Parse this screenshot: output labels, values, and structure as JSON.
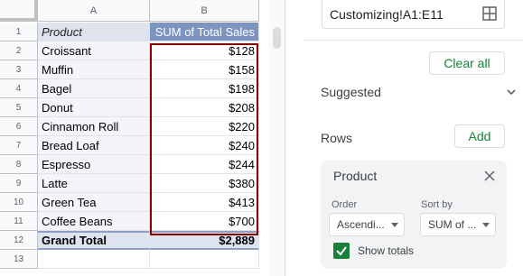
{
  "sheet": {
    "columns": [
      "A",
      "B"
    ],
    "row_numbers": [
      "1",
      "2",
      "3",
      "4",
      "5",
      "6",
      "7",
      "8",
      "9",
      "10",
      "11",
      "12",
      "13"
    ],
    "header": {
      "product": "Product",
      "sales": "SUM of Total Sales"
    },
    "rows": [
      {
        "product": "Croissant",
        "sales": "$128"
      },
      {
        "product": "Muffin",
        "sales": "$158"
      },
      {
        "product": "Bagel",
        "sales": "$198"
      },
      {
        "product": "Donut",
        "sales": "$208"
      },
      {
        "product": "Cinnamon Roll",
        "sales": "$220"
      },
      {
        "product": "Bread Loaf",
        "sales": "$240"
      },
      {
        "product": "Espresso",
        "sales": "$244"
      },
      {
        "product": "Latte",
        "sales": "$380"
      },
      {
        "product": "Green Tea",
        "sales": "$413"
      },
      {
        "product": "Coffee Beans",
        "sales": "$700"
      }
    ],
    "total": {
      "label": "Grand Total",
      "value": "$2,889"
    }
  },
  "pivot_editor": {
    "range": "Customizing!A1:E11",
    "clear_all": "Clear all",
    "suggested": "Suggested",
    "rows_label": "Rows",
    "add": "Add",
    "row_card": {
      "title": "Product",
      "order_label": "Order",
      "order_value": "Ascendi...",
      "sort_by_label": "Sort by",
      "sort_by_value": "SUM of ...",
      "show_totals": "Show totals",
      "show_totals_checked": true
    }
  },
  "colors": {
    "accent_green": "#188038",
    "header_blue": "#7d94c0",
    "selection_border": "#8b0000"
  }
}
